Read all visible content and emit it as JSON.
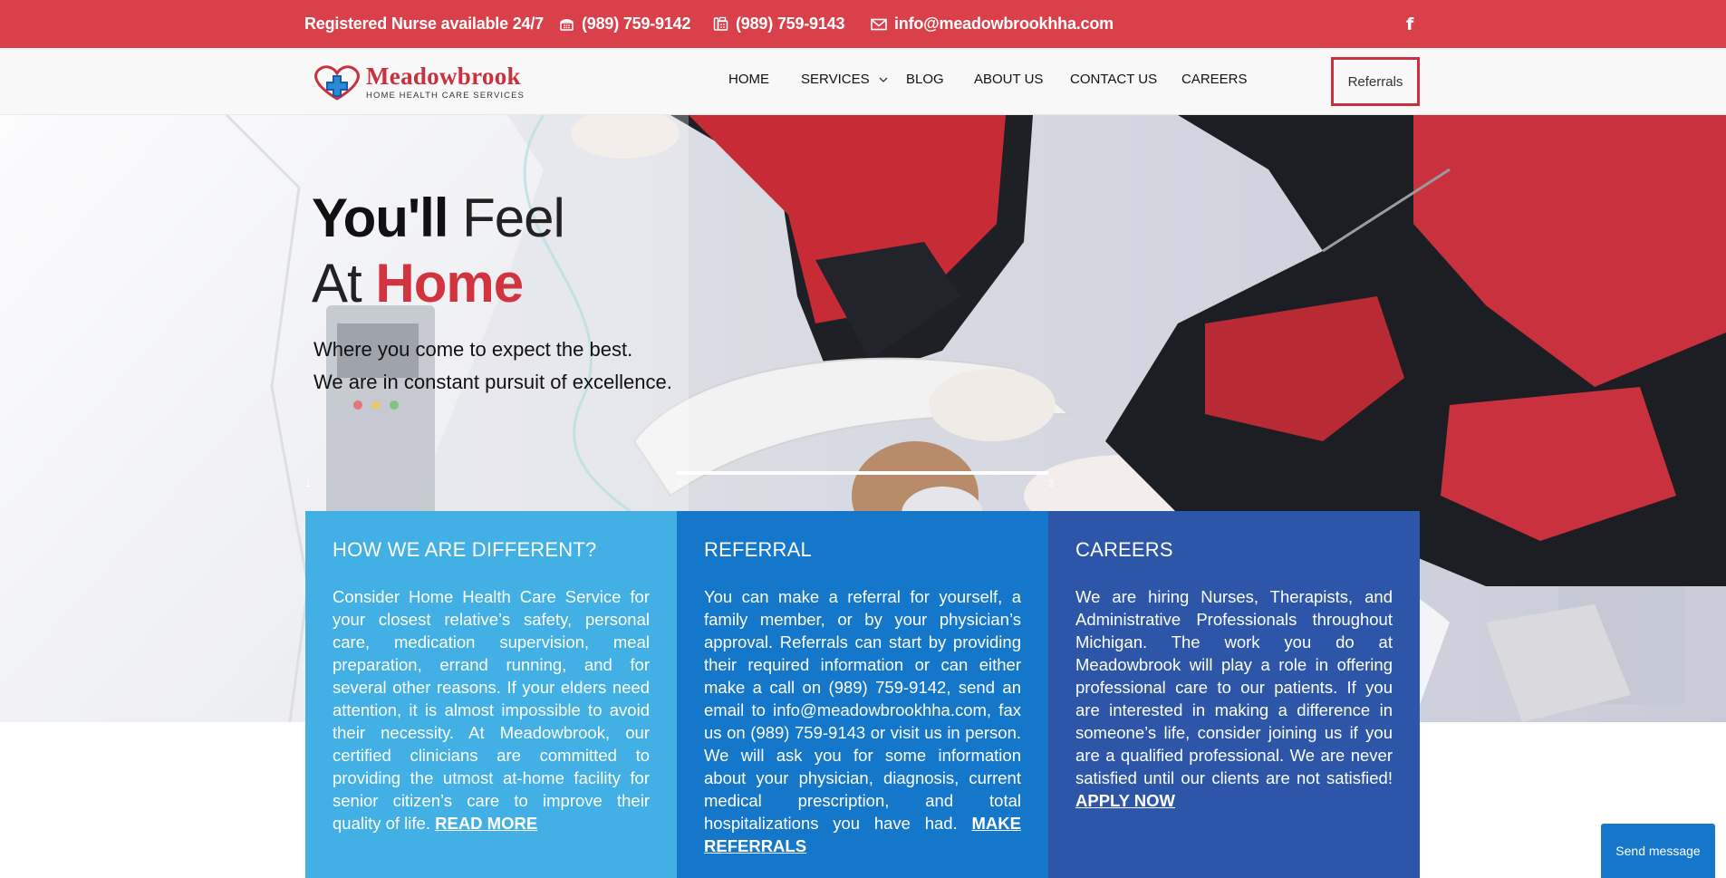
{
  "topbar": {
    "nurse_text": "Registered Nurse available 24/7",
    "phone": "(989) 759-9142",
    "fax": "(989) 759-9143",
    "email": "info@meadowbrookhha.com",
    "facebook": "f"
  },
  "logo": {
    "name": "Meadowbrook",
    "tagline": "HOME HEALTH CARE SERVICES"
  },
  "nav": {
    "home": "HOME",
    "services": "SERVICES",
    "blog": "BLOG",
    "about": "ABOUT US",
    "contact": "CONTACT US",
    "careers": "CAREERS",
    "referrals": "Referrals"
  },
  "hero": {
    "title_bold_1": "You'll",
    "title_light_1": "Feel",
    "title_light_2": "At",
    "title_red": "Home",
    "sub_1": "Where you come to expect the best.",
    "sub_2": "We are in constant pursuit of excellence.",
    "slides": [
      "1",
      "2",
      "3"
    ],
    "active_slide": 2
  },
  "cards": [
    {
      "title": "HOW WE ARE DIFFERENT?",
      "body": "Consider Home Health Care Service for your closest relative’s safety, personal care, medication supervision, meal preparation, errand running, and for several other reasons. If your elders need attention, it is almost impossible to avoid their necessity. At Meadowbrook, our certified clinicians are committed to providing the utmost at-home facility for senior citizen’s care to improve their quality of life.",
      "link": "READ MORE"
    },
    {
      "title": "REFERRAL",
      "body": "You can make a referral for yourself, a family member, or by your physician’s approval. Referrals can start by providing their required information or can either make a call on (989) 759-9142, send an email to info@meadowbrookhha.com, fax us on (989) 759-9143 or visit us in person. We will ask you for some information about your physician, diagnosis, current medical prescription, and total hospitalizations you have had.",
      "link": "MAKE REFERRALS"
    },
    {
      "title": "CAREERS",
      "body": "We are hiring Nurses, Therapists, and Administrative Professionals throughout Michigan. The work you do at Meadowbrook will play a role in offering professional care to our patients. If you are interested in making a difference in someone’s life, consider joining us if you are a qualified professional. We are never satisfied until our clients are not satisfied!",
      "link": "APPLY NOW"
    }
  ],
  "chat": {
    "label": "Send message"
  },
  "colors": {
    "topbar": "#d94049",
    "brand_red": "#c8313d",
    "card1": "#42b0e4",
    "card2": "#1577c9",
    "card3": "#2d56a8"
  }
}
